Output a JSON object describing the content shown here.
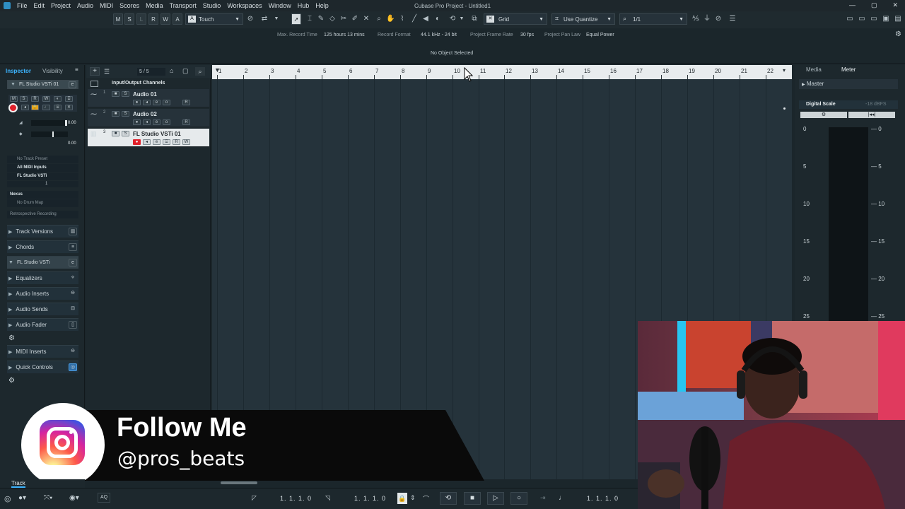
{
  "window": {
    "title": "Cubase Pro Project - Untitled1",
    "controls": [
      "—",
      "▢",
      "✕"
    ]
  },
  "menu": [
    "File",
    "Edit",
    "Project",
    "Audio",
    "MIDI",
    "Scores",
    "Media",
    "Transport",
    "Studio",
    "Workspaces",
    "Window",
    "Hub",
    "Help"
  ],
  "toolbar": {
    "state_buttons": [
      "M",
      "S",
      "L",
      "R",
      "W",
      "A"
    ],
    "automation_mode": "Touch",
    "snap_type": "Grid",
    "quantize_mode": "Use Quantize",
    "quantize_value": "1/1"
  },
  "info_line": {
    "max_record_label": "Max. Record Time",
    "max_record_value": "125 hours 13 mins",
    "record_format_label": "Record Format",
    "record_format_value": "44.1 kHz - 24 bit",
    "frame_rate_label": "Project Frame Rate",
    "frame_rate_value": "30 fps",
    "pan_law_label": "Project Pan Law",
    "pan_law_value": "Equal Power"
  },
  "selection_status": "No Object Selected",
  "inspector": {
    "tabs": [
      "Inspector",
      "Visibility"
    ],
    "track_name": "FL Studio VSTi 01",
    "vol_value": "0.00",
    "pan_value": "0.00",
    "fields": [
      "No Track Preset",
      "All MIDI Inputs",
      "FL Studio VSTi"
    ],
    "channel_value": "1",
    "instrument": "Nexus",
    "drum_map": "No Drum Map",
    "retro_record": "Retrospective Recording",
    "sections": [
      "Track Versions",
      "Chords",
      "FL Studio VSTi",
      "Equalizers",
      "Audio Inserts",
      "Audio Sends",
      "Audio Fader",
      "MIDI Inserts",
      "Quick Controls"
    ]
  },
  "tracklist": {
    "counter": "5 / 5",
    "folder": "Input/Output Channels",
    "tracks": [
      {
        "num": "1",
        "name": "Audio 01"
      },
      {
        "num": "2",
        "name": "Audio 02"
      },
      {
        "num": "3",
        "name": "FL Studio VSTi 01"
      }
    ]
  },
  "ruler": [
    "1",
    "2",
    "3",
    "4",
    "5",
    "6",
    "7",
    "8",
    "9",
    "10",
    "11",
    "12",
    "13",
    "14",
    "15",
    "16",
    "17",
    "18",
    "19",
    "20",
    "21",
    "22"
  ],
  "right_zone": {
    "tabs": [
      "Media",
      "Meter"
    ],
    "channel": "Master",
    "scale_type": "Digital Scale",
    "scale_value": "-18 dBFS",
    "scale_marks": [
      "0",
      "5",
      "10",
      "15",
      "20",
      "25"
    ]
  },
  "transport": {
    "left_locator": "1. 1. 1.  0",
    "right_locator": "1. 1. 1.  0",
    "primary_position": "1. 1. 1.  0"
  },
  "bottom_tab": "Track",
  "overlay": {
    "title": "Follow Me",
    "handle": "@pros_beats"
  },
  "colors": {
    "accent_blue": "#3db5ff",
    "record_red": "#e0202a",
    "bg": "#1b262b"
  }
}
